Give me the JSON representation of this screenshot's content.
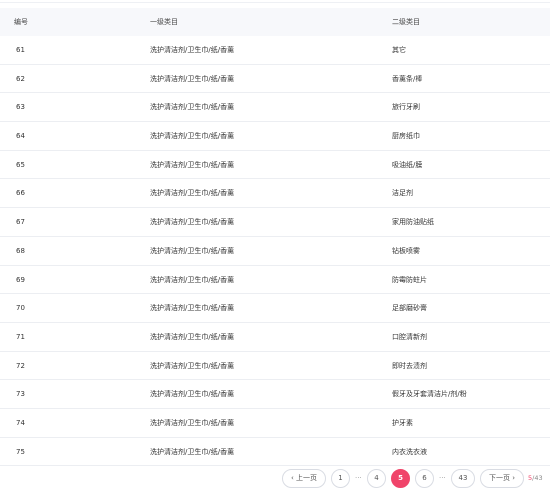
{
  "table": {
    "headers": {
      "id": "编号",
      "level1": "一级类目",
      "level2": "二级类目"
    },
    "rows": [
      {
        "id": "61",
        "level1": "洗护清洁剂/卫生巾/纸/香薰",
        "level2": "其它"
      },
      {
        "id": "62",
        "level1": "洗护清洁剂/卫生巾/纸/香薰",
        "level2": "香薰条/棒"
      },
      {
        "id": "63",
        "level1": "洗护清洁剂/卫生巾/纸/香薰",
        "level2": "旅行牙刷"
      },
      {
        "id": "64",
        "level1": "洗护清洁剂/卫生巾/纸/香薰",
        "level2": "厨房纸巾"
      },
      {
        "id": "65",
        "level1": "洗护清洁剂/卫生巾/纸/香薰",
        "level2": "吸油纸/膜"
      },
      {
        "id": "66",
        "level1": "洗护清洁剂/卫生巾/纸/香薰",
        "level2": "洁足剂"
      },
      {
        "id": "67",
        "level1": "洗护清洁剂/卫生巾/纸/香薰",
        "level2": "家用防油贴纸"
      },
      {
        "id": "68",
        "level1": "洗护清洁剂/卫生巾/纸/香薰",
        "level2": "钻板喷雾"
      },
      {
        "id": "69",
        "level1": "洗护清洁剂/卫生巾/纸/香薰",
        "level2": "防霉防蛀片"
      },
      {
        "id": "70",
        "level1": "洗护清洁剂/卫生巾/纸/香薰",
        "level2": "足部磨砂膏"
      },
      {
        "id": "71",
        "level1": "洗护清洁剂/卫生巾/纸/香薰",
        "level2": "口腔清新剂"
      },
      {
        "id": "72",
        "level1": "洗护清洁剂/卫生巾/纸/香薰",
        "level2": "即时去渍剂"
      },
      {
        "id": "73",
        "level1": "洗护清洁剂/卫生巾/纸/香薰",
        "level2": "假牙及牙套清洁片/剂/粉"
      },
      {
        "id": "74",
        "level1": "洗护清洁剂/卫生巾/纸/香薰",
        "level2": "护牙素"
      },
      {
        "id": "75",
        "level1": "洗护清洁剂/卫生巾/纸/香薰",
        "level2": "内衣洗衣液"
      }
    ]
  },
  "pagination": {
    "prev_label": "‹ 上一页",
    "next_label": "下一页 ›",
    "pages": [
      "1",
      "4",
      "5",
      "6",
      "43"
    ],
    "ellipsis": "···",
    "current_page": "5",
    "total_text": "/43",
    "accent_color": "#f0446a"
  }
}
